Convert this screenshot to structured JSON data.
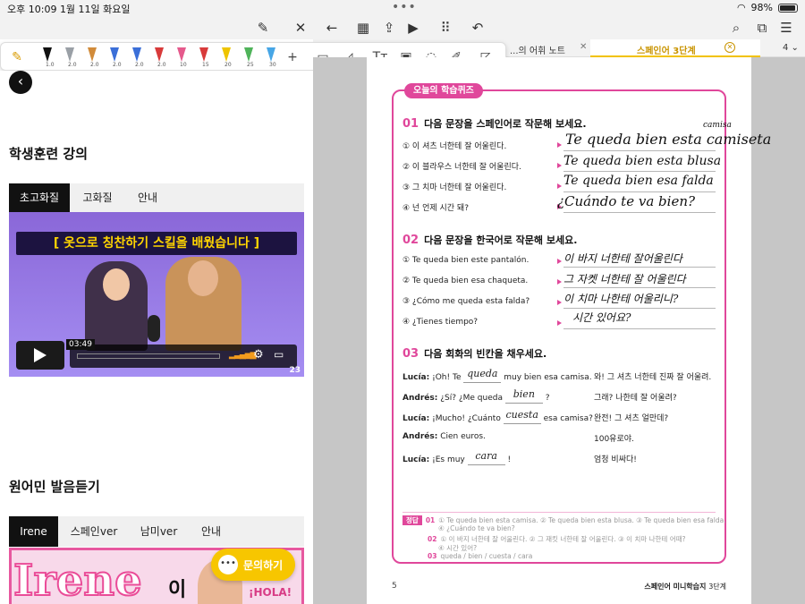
{
  "status": {
    "time": "오후 10:09",
    "date": "1월 11일 화요일",
    "battery": "98%"
  },
  "tabs": {
    "tab1_label": "...의 어휘 노트",
    "tab2_label": "스페인어 3단계",
    "count": "4"
  },
  "pen_sizes": [
    "1.0",
    "2.0",
    "2.0",
    "2.0",
    "2.0",
    "2.0",
    "10",
    "15",
    "20",
    "25",
    "30"
  ],
  "pen_colors": [
    "#111111",
    "#9aa0a6",
    "#d18b3a",
    "#3b6fd8",
    "#3b6fd8",
    "#d83a3a",
    "#e55a8c",
    "#d83a3a",
    "#eec400",
    "#4fb35a",
    "#47a6e6"
  ],
  "left": {
    "section1_title": "학생훈련 강의",
    "section1_tabs": [
      "초고화질",
      "고화질",
      "안내"
    ],
    "video": {
      "banner": "[ 옷으로 칭찬하기 스킬을 배웠습니다 ]",
      "duration": "03:49",
      "logo": "23"
    },
    "section2_title": "원어민 발음듣기",
    "section2_tabs": [
      "Irene",
      "스페인ver",
      "남미ver",
      "안내"
    ],
    "card": {
      "name": "Irene",
      "suffix": "이",
      "hola": "¡HOLA!"
    },
    "chat_button": "문의하기"
  },
  "doc": {
    "badge": "오늘의 학습퀴즈",
    "q1": {
      "num": "01",
      "title": "다음 문장을 스페인어로 작문해 보세요.",
      "items": [
        "① 이 셔츠 너한테 잘 어울린다.",
        "② 이 블라우스 너한테 잘 어울린다.",
        "③ 그 치마 너한테 잘 어울린다.",
        "④ 넌 언제 시간 돼?"
      ],
      "handwriting": [
        "Te queda bien esta camiseta",
        "Te queda bien esta blusa",
        "Te queda bien esa falda",
        "¿Cuándo te va bien?"
      ],
      "correction": "camisa"
    },
    "q2": {
      "num": "02",
      "title": "다음 문장을 한국어로 작문해 보세요.",
      "items": [
        "① Te queda bien este pantalón.",
        "② Te queda bien esa chaqueta.",
        "③ ¿Cómo me queda esta falda?",
        "④ ¿Tienes tiempo?"
      ],
      "handwriting": [
        "이 바지 너한테 잘어울린다",
        "그 자켓 너한테 잘 어울린다",
        "이 치마 나한테 어울리니?",
        "시간 있어요?"
      ]
    },
    "q3": {
      "num": "03",
      "title": "다음 회화의 빈칸을 채우세요.",
      "lines": [
        {
          "speaker": "Lucía:",
          "pre": "¡Oh! Te",
          "blank": "queda",
          "post": "muy bien esa camisa.",
          "kr": "와! 그 셔츠 너한테 진짜 잘 어울려."
        },
        {
          "speaker": "Andrés:",
          "pre": "¿Sí? ¿Me queda",
          "blank": "bien",
          "post": "?",
          "kr": "그래? 나한테 잘 어울려?"
        },
        {
          "speaker": "Lucía:",
          "pre": "¡Mucho! ¿Cuánto",
          "blank": "cuesta",
          "post": "esa camisa?",
          "kr": "완전! 그 셔츠 얼만데?"
        },
        {
          "speaker": "Andrés:",
          "pre": "Cien euros.",
          "blank": "",
          "post": "",
          "kr": "100유로야."
        },
        {
          "speaker": "Lucía:",
          "pre": "¡Es muy",
          "blank": "cara",
          "post": "!",
          "kr": "엄청 비싸다!"
        }
      ]
    },
    "answers": {
      "label": "정답",
      "a1_num": "01",
      "a1": "① Te queda bien esta camisa. ② Te queda bien esta blusa. ③ Te queda bien esa falda.",
      "a1b": "④ ¿Cuándo te va bien?",
      "a2_num": "02",
      "a2": "① 이 바지 너한테 잘 어울린다. ② 그 재킷 너한테 잘 어울린다. ③ 이 치마 나한테 어때?",
      "a2b": "④ 시간 있어?",
      "a3_num": "03",
      "a3": "queda / bien / cuesta / cara"
    },
    "page_num": "5",
    "footer_title": "스페인어 미니학습지",
    "footer_level": "3단계"
  }
}
